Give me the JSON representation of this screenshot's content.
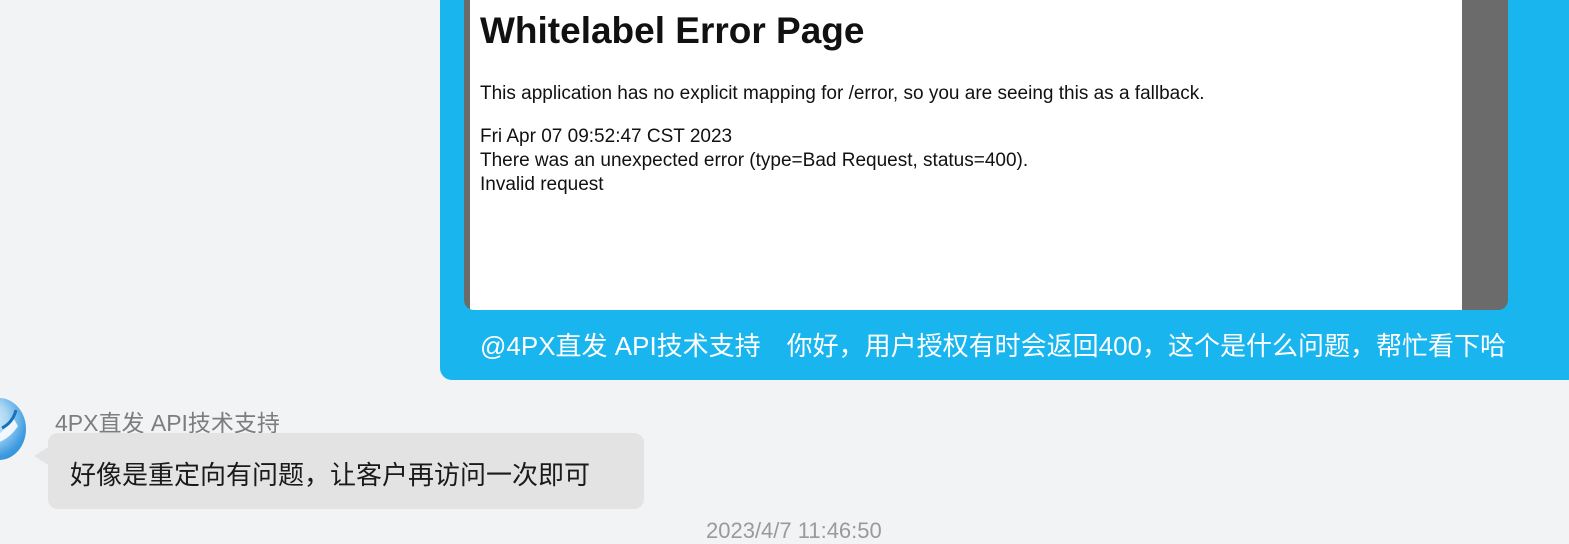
{
  "outgoing_message": {
    "screenshot": {
      "title": "Whitelabel Error Page",
      "description": "This application has no explicit mapping for /error, so you are seeing this as a fallback.",
      "timestamp": "Fri Apr 07 09:52:47 CST 2023",
      "error_type": "There was an unexpected error (type=Bad Request, status=400).",
      "error_message": "Invalid request"
    },
    "text": "@4PX直发 API技术支持　你好，用户授权有时会返回400，这个是什么问题，帮忙看下哈"
  },
  "incoming_message": {
    "sender": "4PX直发 API技术支持",
    "text": "好像是重定向有问题，让客户再访问一次即可",
    "avatar_icon": "bird-logo-icon"
  },
  "timestamp": "2023/4/7 11:46:50",
  "colors": {
    "outgoing_bubble": "#19b5ee",
    "incoming_bubble": "#e3e3e3",
    "background": "#f2f3f5"
  }
}
